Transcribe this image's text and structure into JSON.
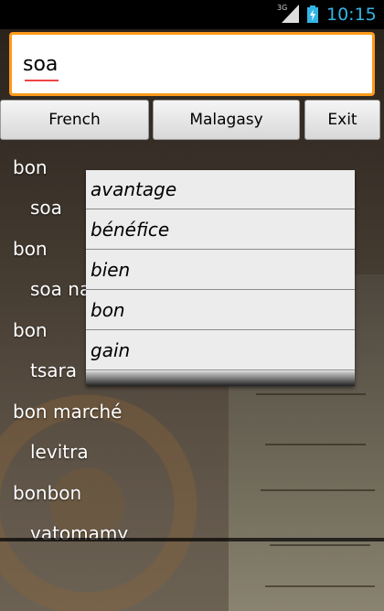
{
  "status_bar": {
    "network": "3G",
    "time": "10:15"
  },
  "search": {
    "value": "soa"
  },
  "buttons": {
    "source_lang": "French",
    "target_lang": "Malagasy",
    "exit": "Exit"
  },
  "results": [
    {
      "term": "bon",
      "translation": "soa"
    },
    {
      "term": "bon",
      "translation": "soa na"
    },
    {
      "term": "bon",
      "translation": "tsara"
    },
    {
      "term": "bon marché",
      "translation": "levitra"
    },
    {
      "term": "bonbon",
      "translation": "vatomamy"
    }
  ],
  "suggestions": [
    "avantage",
    "bénéfice",
    "bien",
    "bon",
    "gain"
  ],
  "colors": {
    "search_border": "#ff9a1a",
    "clock": "#33b5e5"
  }
}
